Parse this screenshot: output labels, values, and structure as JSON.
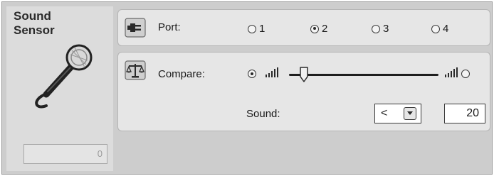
{
  "block": {
    "title": "Sound\nSensor",
    "icon": "microphone-icon",
    "readout": "0"
  },
  "port": {
    "label": "Port:",
    "icon": "port-plug-icon",
    "options": [
      "1",
      "2",
      "3",
      "4"
    ],
    "selected": "2"
  },
  "compare": {
    "label": "Compare:",
    "icon": "balance-scale-icon",
    "left_radio_selected": true,
    "right_radio_selected": false,
    "slider_level": 0.1,
    "sound_label": "Sound:",
    "operator": "<",
    "threshold": "20"
  }
}
